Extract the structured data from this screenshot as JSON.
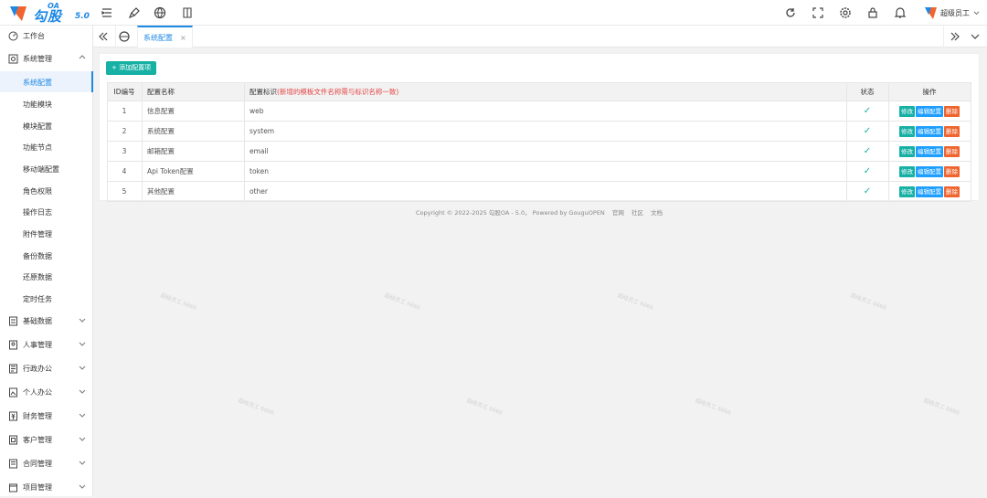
{
  "app": {
    "logo_oa": "OA",
    "logo_name": "勾股",
    "logo_version": "5.0",
    "user_name": "超级员工"
  },
  "topbar_icons": [
    "menu-toggle-icon",
    "clean-cache-icon",
    "globe-icon",
    "book-icon"
  ],
  "topbar_right_icons": [
    "refresh-icon",
    "fullscreen-icon",
    "gear-icon",
    "lock-icon",
    "bell-icon"
  ],
  "sidebar": {
    "workbench": "工作台",
    "system": "系统管理",
    "system_items": [
      "系统配置",
      "功能模块",
      "模块配置",
      "功能节点",
      "移动端配置",
      "角色权限",
      "操作日志",
      "附件管理",
      "备份数据",
      "还原数据",
      "定时任务"
    ],
    "groups": [
      "基础数据",
      "人事管理",
      "行政办公",
      "个人办公",
      "财务管理",
      "客户管理",
      "合同管理",
      "项目管理"
    ]
  },
  "tabs": {
    "active": "系统配置",
    "close": "×"
  },
  "toolbar": {
    "add_label": "+ 添加配置项"
  },
  "table": {
    "headers": {
      "id": "ID编号",
      "name": "配置名称",
      "key": "配置标识",
      "key_hint": "(新增的模板文件名称需与标识名称一致)",
      "status": "状态",
      "ops": "操作"
    },
    "rows": [
      {
        "id": "1",
        "name": "信息配置",
        "key": "web"
      },
      {
        "id": "2",
        "name": "系统配置",
        "key": "system"
      },
      {
        "id": "3",
        "name": "邮箱配置",
        "key": "email"
      },
      {
        "id": "4",
        "name": "Api Token配置",
        "key": "token"
      },
      {
        "id": "5",
        "name": "其他配置",
        "key": "other"
      }
    ],
    "status_mark": "✓",
    "op_labels": {
      "edit": "修改",
      "config": "编辑配置",
      "delete": "删除"
    }
  },
  "footer": {
    "copyright": "Copyright © 2022-2025 勾股OA - 5.0， Powered by GouguOPEN",
    "links": [
      "官网",
      "社区",
      "文档"
    ]
  },
  "watermark": "超级员工 6666",
  "colors": {
    "accent": "#1e88e5",
    "teal": "#16b0a4",
    "blue": "#1e9fff",
    "orange": "#f0652f",
    "hint_red": "#e54545"
  }
}
